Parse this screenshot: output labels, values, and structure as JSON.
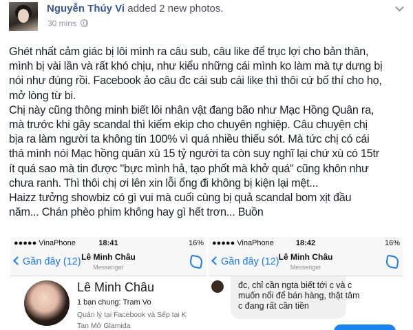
{
  "post": {
    "author": "Nguyễn Thúy Vi",
    "action": " added 2 new photos.",
    "time": "30 mins",
    "paragraphs": [
      "Ghét nhất cảm giác bị lôi mình ra câu sub, câu like để trục lợi cho bản thân,",
      "mình bị vài lần và rất khó chịu, như kiểu những cái mình ko làm mà tự dưng bị",
      "nói như đúng rồi. Facebook ảo câu đc cái sub cái like thì thôi cứ bố thí cho họ,",
      "mở lòng từ bi.",
      "Chị này cũng thông minh biết lôi nhân vật đang bão như Mạc Hồng Quân ra,",
      "mà trước khi gây scandal thì kiếm ekip cho chuyên nghiệp. Câu chuyện chị",
      "bịa ra làm người ta không tin 100% vì quá nhiều thiếu sót. Mà tức chị có cái",
      "thá mình nói Mạc hồng quân xù 15 tỷ người ta còn suy nghĩ lại chứ xù có 15tr",
      "ít quá sao mà tin được \"bực mình hả, tạo phốt mà khở quá\" cũng khôn như",
      "chưa ranh. Thì thôi chị ơi lên xin lỗi ổng đi không bị kiện lại mệt...",
      "Haizz tưởng showbiz có gì vui mà cuối cùng bị quả scandal bom xịt đầu",
      "năm... Chán phèo phim không hay gì hết trơn... Buồn"
    ]
  },
  "photo_left": {
    "carrier": "●●●●● VinaPhone",
    "time": "18:41",
    "battery": "16%",
    "back_label": "Gần đây (12)",
    "contact": "Lê Minh Châu",
    "app": "Messenger",
    "profile_name": "Lê Minh Châu",
    "mutual": "1 bạn chung: Tram Vo",
    "work_line1": "Quản lý tại Facebook và Sếp tại K",
    "work_line2": "Tan Mở Glamida"
  },
  "photo_right": {
    "carrier": "●●●●● VinaPhone",
    "time": "18:42",
    "battery": "16%",
    "back_label": "Gần đây (12)",
    "contact": "Lê Minh Châu",
    "app": "Messenger",
    "message_lines": [
      "đc, chỉ cần ngta biết tới c và c",
      "muốn nổi để bán hàng, thật tâm",
      "c đang rất cần tiền"
    ]
  },
  "colors": {
    "link": "#365899",
    "ios_blue": "#1a7cf0",
    "text": "#1d2129"
  }
}
